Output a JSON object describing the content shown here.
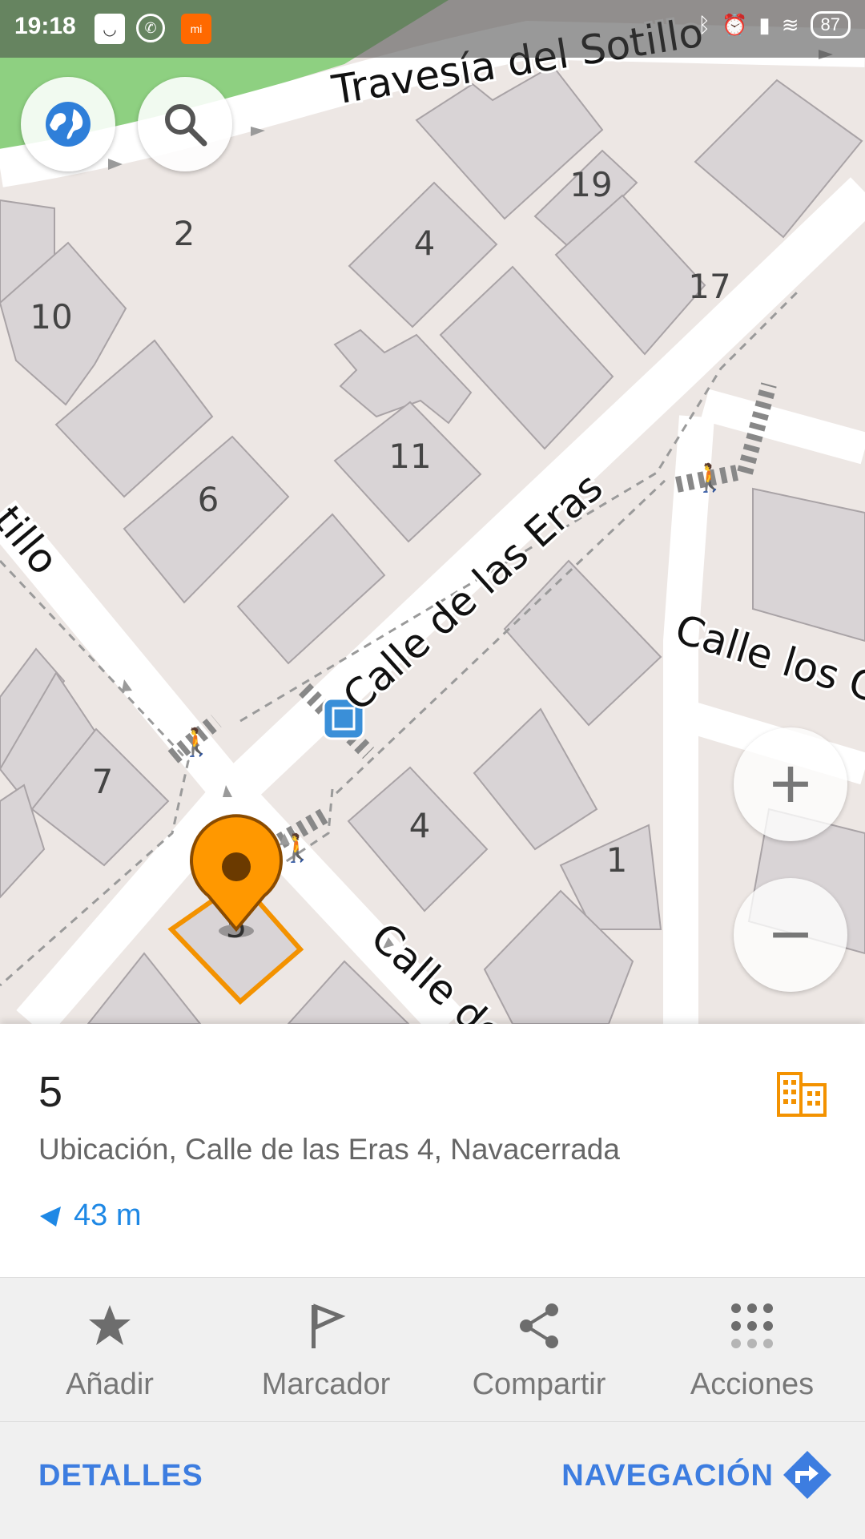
{
  "status_bar": {
    "time": "19:18",
    "battery": "87",
    "notification_icons": [
      "smile-icon",
      "whatsapp-icon",
      "mi-icon"
    ],
    "system_icons": [
      "bluetooth-icon",
      "alarm-icon",
      "signal-icon",
      "wifi-icon"
    ]
  },
  "map": {
    "streets": [
      "Travesía del Sotillo",
      "tillo",
      "Calle de las Eras",
      "Calle los Corra",
      "Calle de"
    ],
    "house_numbers": [
      "19",
      "2",
      "4",
      "17",
      "10",
      "11",
      "6",
      "7",
      "4",
      "1",
      "5"
    ],
    "controls": {
      "layers_icon": "globe-icon",
      "search_icon": "search-icon",
      "zoom_in": "+",
      "zoom_out": "−"
    },
    "colors": {
      "building": "#d9d4d6",
      "ground": "#ede7e4",
      "road": "#ffffff",
      "park": "#8ed081",
      "marker": "#ff9800",
      "selected_outline": "#f39200"
    }
  },
  "place": {
    "title": "5",
    "address": "Ubicación, Calle de las Eras 4, Navacerrada",
    "distance": "43 m",
    "type_icon": "building-icon"
  },
  "actions": [
    {
      "label": "Añadir",
      "icon": "star-icon"
    },
    {
      "label": "Marcador",
      "icon": "flag-icon"
    },
    {
      "label": "Compartir",
      "icon": "share-icon"
    },
    {
      "label": "Acciones",
      "icon": "grid-icon"
    }
  ],
  "bottom_bar": {
    "details": "DETALLES",
    "navigation": "NAVEGACIÓN"
  },
  "accent_color": "#3d7de0"
}
